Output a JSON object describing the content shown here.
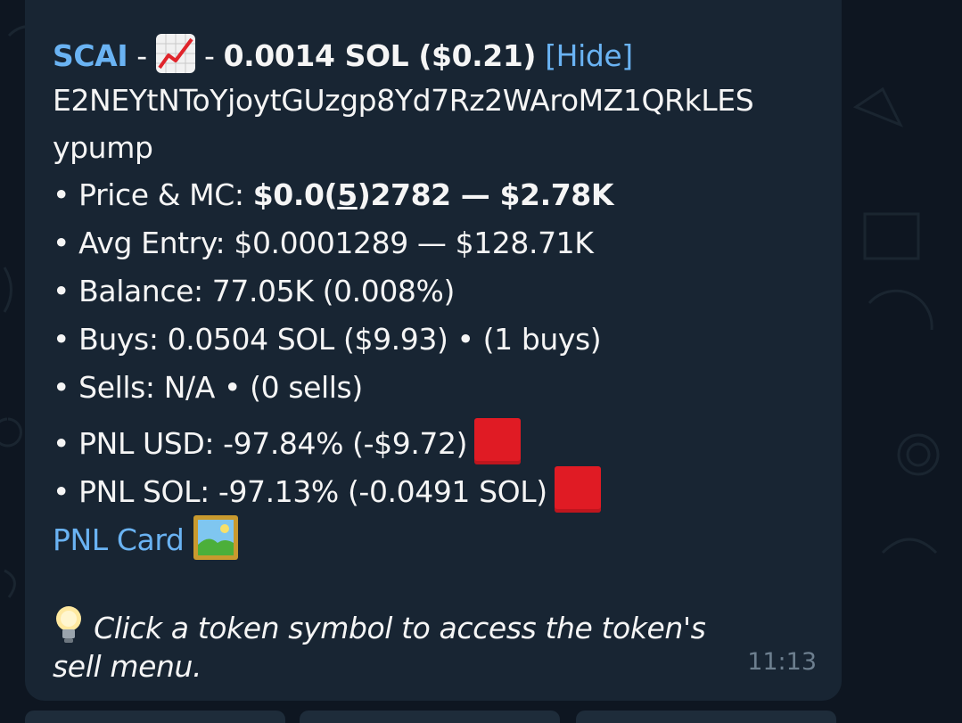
{
  "message": {
    "symbol_link": "SCAI",
    "sep1": " - ",
    "chart_icon": "chart-increasing-icon",
    "sep2": " - ",
    "header_amount": "0.0014 SOL ($0.21)",
    "hide_link": "[Hide]",
    "address_line1": "E2NEYtNToYjoytGUzgp8Yd7Rz2WAroMZ1QRkLES",
    "address_line2": "ypump",
    "price_label": "• Price & MC: ",
    "price_prefix": "$0.0(",
    "price_zeros": "5",
    "price_suffix": ")2782 — $2.78K",
    "avg_entry": "• Avg Entry: $0.0001289 — $128.71K",
    "balance": "• Balance: 77.05K (0.008%)",
    "buys": "• Buys: 0.0504 SOL ($9.93) • (1 buys)",
    "sells": "• Sells: N/A • (0 sells)",
    "pnl_usd": "• PNL USD: -97.84% (-$9.72)",
    "pnl_sol": "• PNL SOL: -97.13% (-0.0491 SOL)",
    "red_square_icon": "red-square-icon",
    "pnl_card_link": "PNL Card",
    "picture_icon": "framed-picture-icon",
    "hint_line1": " Click a token symbol to access the token's",
    "hint_line2": "sell menu.",
    "bulb_icon": "light-bulb-icon",
    "time": "11:13"
  },
  "colors": {
    "background": "#0e1621",
    "bubble": "#182533",
    "link": "#6ab3f3",
    "text": "#f5f5f5",
    "time": "#6d7f8f",
    "red_square": "#e01b24"
  }
}
